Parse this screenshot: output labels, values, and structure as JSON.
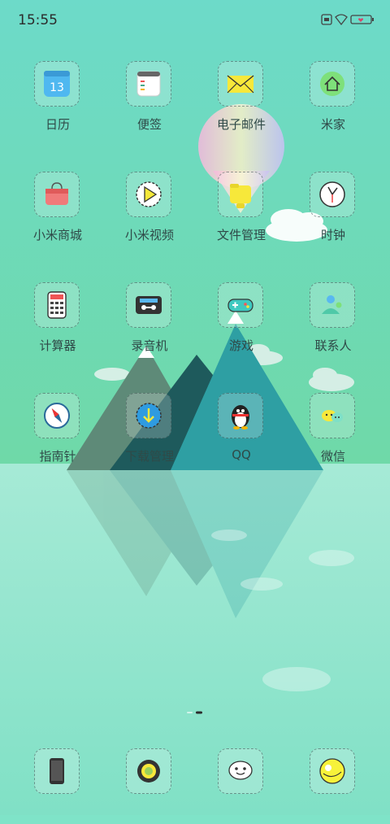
{
  "status_bar": {
    "time": "15:55",
    "icons": [
      "sim-icon",
      "wifi-icon",
      "battery-icon"
    ]
  },
  "apps": [
    {
      "label": "日历",
      "icon": "calendar-icon",
      "badge_text": "13"
    },
    {
      "label": "便签",
      "icon": "notes-icon"
    },
    {
      "label": "电子邮件",
      "icon": "email-icon"
    },
    {
      "label": "米家",
      "icon": "home-icon"
    },
    {
      "label": "小米商城",
      "icon": "shopping-bag-icon"
    },
    {
      "label": "小米视频",
      "icon": "play-icon"
    },
    {
      "label": "文件管理",
      "icon": "folder-icon"
    },
    {
      "label": "时钟",
      "icon": "clock-icon"
    },
    {
      "label": "计算器",
      "icon": "calculator-icon"
    },
    {
      "label": "录音机",
      "icon": "cassette-icon"
    },
    {
      "label": "游戏",
      "icon": "gamepad-icon"
    },
    {
      "label": "联系人",
      "icon": "contacts-icon"
    },
    {
      "label": "指南针",
      "icon": "compass-icon"
    },
    {
      "label": "下载管理",
      "icon": "download-icon"
    },
    {
      "label": "QQ",
      "icon": "qq-penguin-icon"
    },
    {
      "label": "微信",
      "icon": "wechat-icon"
    }
  ],
  "dock": [
    {
      "icon": "phone-icon"
    },
    {
      "icon": "camera-icon"
    },
    {
      "icon": "messages-icon"
    },
    {
      "icon": "browser-icon"
    }
  ],
  "page_indicator": {
    "total": 2,
    "current": 2
  },
  "colors": {
    "sky": "#6fd9c8",
    "mountain": "#2f9f9c",
    "label": "#2f4a48"
  }
}
